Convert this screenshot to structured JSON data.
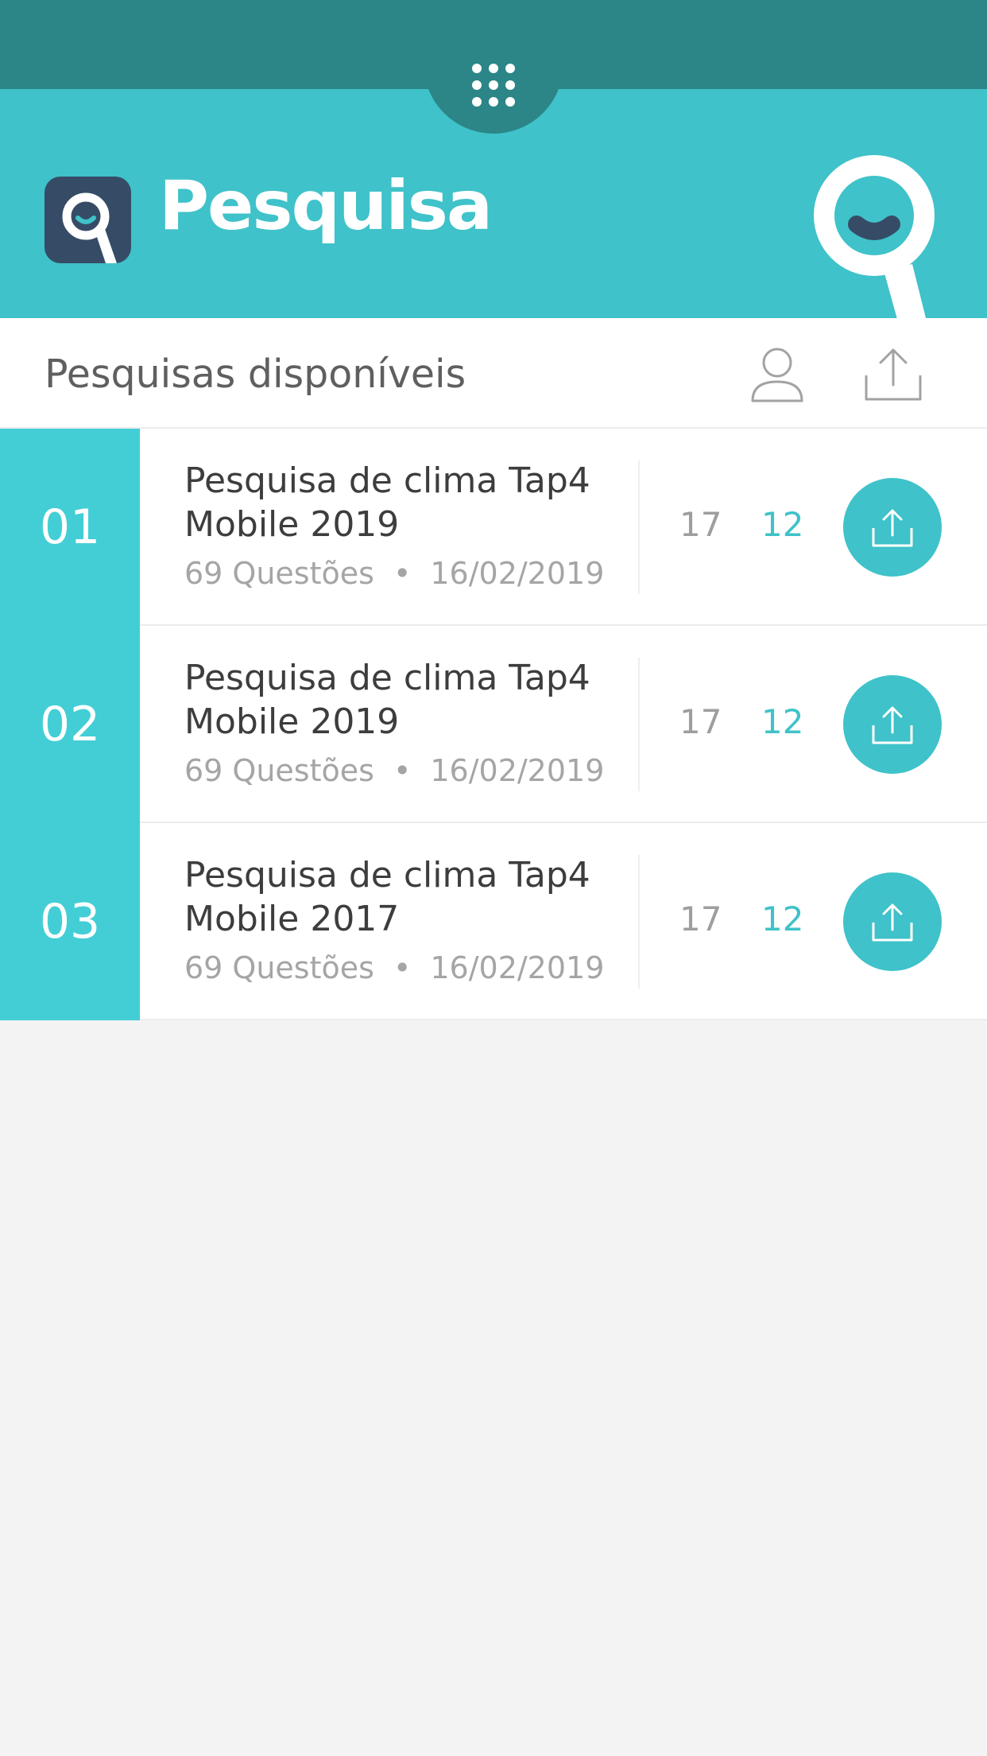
{
  "header": {
    "app_title": "Pesquisa",
    "menu_icon": "grid-menu-icon",
    "logo_icon": "magnifier-smile-logo-icon",
    "colors": {
      "accent": "#3fc2c9",
      "topbar": "#2c8586",
      "logo_bg": "#364c66"
    }
  },
  "subheader": {
    "title": "Pesquisas disponíveis",
    "user_icon": "user-icon",
    "upload_icon": "upload-icon"
  },
  "surveys": [
    {
      "number": "01",
      "title": "Pesquisa de clima Tap4 Mobile 2019",
      "questions": "69 Questões",
      "date": "16/02/2019",
      "count_a": "17",
      "count_b": "12",
      "action_icon": "upload-icon"
    },
    {
      "number": "02",
      "title": "Pesquisa de clima Tap4 Mobile 2019",
      "questions": "69 Questões",
      "date": "16/02/2019",
      "count_a": "17",
      "count_b": "12",
      "action_icon": "upload-icon"
    },
    {
      "number": "03",
      "title": "Pesquisa de clima Tap4 Mobile 2017",
      "questions": "69 Questões",
      "date": "16/02/2019",
      "count_a": "17",
      "count_b": "12",
      "action_icon": "upload-icon"
    }
  ],
  "meta_separator": "•"
}
